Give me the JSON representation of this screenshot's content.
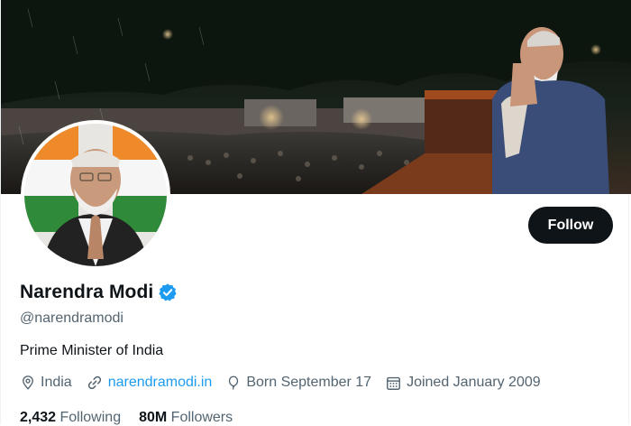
{
  "profile": {
    "name": "Narendra Modi",
    "handle": "@narendramodi",
    "bio": "Prime Minister of India",
    "location": "India",
    "website": "narendramodi.in",
    "birthday": "Born September 17",
    "joined": "Joined January 2009"
  },
  "actions": {
    "follow_label": "Follow"
  },
  "stats": {
    "following_count": "2,432",
    "following_label": "Following",
    "followers_count": "80M",
    "followers_label": "Followers"
  },
  "icons": {
    "location": "location-pin-icon",
    "website": "link-icon",
    "birthday": "balloon-icon",
    "joined": "calendar-icon",
    "verified": "verified-badge-icon"
  },
  "colors": {
    "accent": "#1d9bf0",
    "text": "#0f1419",
    "muted": "#536471",
    "button": "#0f1419"
  }
}
